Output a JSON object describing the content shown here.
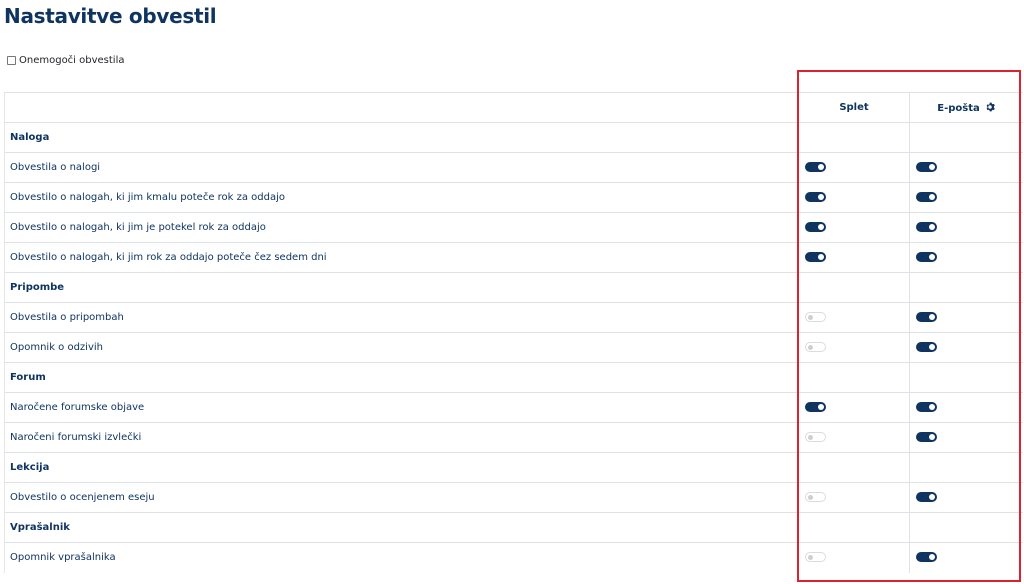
{
  "page": {
    "title": "Nastavitve obvestil"
  },
  "disable": {
    "label": "Onemogoči obvestila",
    "checked": false
  },
  "columns": {
    "web": "Splet",
    "email": "E-pošta",
    "email_icon": "gear-icon"
  },
  "groups": [
    {
      "name": "Naloga",
      "items": [
        {
          "label": "Obvestila o nalogi",
          "web": true,
          "email": true
        },
        {
          "label": "Obvestilo o nalogah, ki jim kmalu poteče rok za oddajo",
          "web": true,
          "email": true
        },
        {
          "label": "Obvestilo o nalogah, ki jim je potekel rok za oddajo",
          "web": true,
          "email": true
        },
        {
          "label": "Obvestilo o nalogah, ki jim rok za oddajo poteče čez sedem dni",
          "web": true,
          "email": true
        }
      ]
    },
    {
      "name": "Pripombe",
      "items": [
        {
          "label": "Obvestila o pripombah",
          "web": false,
          "email": true
        },
        {
          "label": "Opomnik o odzivih",
          "web": false,
          "email": true
        }
      ]
    },
    {
      "name": "Forum",
      "items": [
        {
          "label": "Naročene forumske objave",
          "web": true,
          "email": true
        },
        {
          "label": "Naročeni forumski izvlečki",
          "web": false,
          "email": true
        }
      ]
    },
    {
      "name": "Lekcija",
      "items": [
        {
          "label": "Obvestilo o ocenjenem eseju",
          "web": false,
          "email": true
        }
      ]
    },
    {
      "name": "Vprašalnik",
      "items": [
        {
          "label": "Opomnik vprašalnika",
          "web": false,
          "email": true
        }
      ]
    }
  ],
  "colors": {
    "primary": "#0f3460",
    "highlight": "#d9232e",
    "toggle_off": "#dcdcdc"
  }
}
